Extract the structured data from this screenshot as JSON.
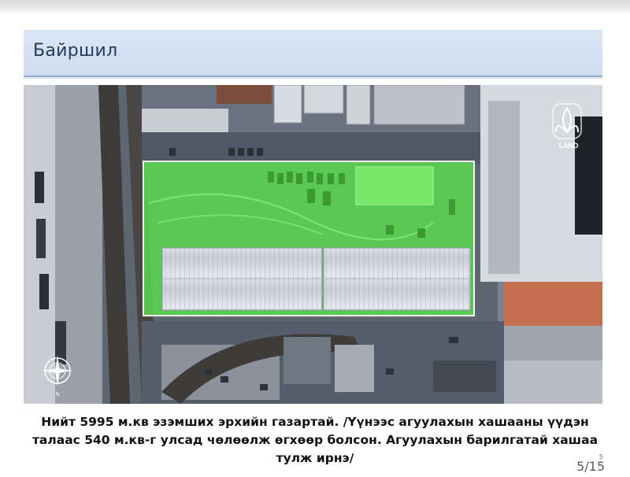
{
  "slide": {
    "title": "Байршил",
    "caption_lines": [
      "Нийт 5995 м.кв эзэмших эрхийн газартай. /Үүнээс агуулахын хашааны үүдэн",
      "талаас 540 м.кв-г улсад чөлөөлж өгхөөр болсон. Агуулахын барилгатай хашаа",
      "тулж ирнэ/"
    ],
    "page_indicator": "5/15",
    "page_marker": "5"
  },
  "map": {
    "logo_text": "LAND",
    "compass_letter": "N",
    "highlight_color": "#5ff04c",
    "icons": [
      "land-logo-icon",
      "compass-icon"
    ]
  }
}
